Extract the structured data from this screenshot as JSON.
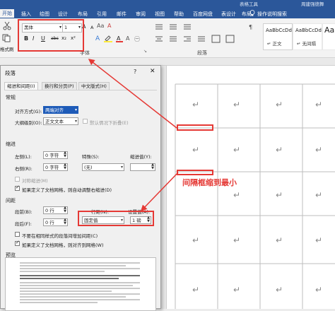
{
  "ribbon": {
    "context_title": "表格工具",
    "user_name": "周建强德舞",
    "tabs": [
      "开始",
      "插入",
      "绘图",
      "设计",
      "布局",
      "引用",
      "邮件",
      "审阅",
      "视图",
      "帮助",
      "百度网盘",
      "表设计",
      "布局"
    ],
    "tell_me": "操作说明搜索",
    "font_name": "黑体",
    "font_size": "1",
    "font_size_inc": "A",
    "font_size_dec": "A",
    "format_buttons": [
      "B",
      "I",
      "U",
      "abc",
      "x₂",
      "x²"
    ],
    "font_group_label": "字体",
    "paragraph_group_label": "段落",
    "clipboard_label": "格式刷",
    "styles": [
      {
        "preview": "AaBbCcDd",
        "name": "↵ 正文"
      },
      {
        "preview": "AaBbCcDd",
        "name": "↵ 无间隔"
      },
      {
        "preview": "AaB",
        "name": ""
      }
    ]
  },
  "dialog": {
    "title": "段落",
    "help": "?",
    "close": "✕",
    "tabs": [
      "缩进和间距(I)",
      "换行和分页(P)",
      "中文版式(H)"
    ],
    "general": {
      "heading": "常规",
      "alignment_label": "对齐方式(G):",
      "alignment_value": "两端对齐",
      "outline_label": "大纲级别(O):",
      "outline_value": "正文文本",
      "collapse_label": "默认情况下折叠(E)"
    },
    "indent": {
      "heading": "缩进",
      "left_label": "左侧(L):",
      "left_value": "0 字符",
      "right_label": "右侧(R):",
      "right_value": "0 字符",
      "special_label": "特殊(S):",
      "special_value": "(无)",
      "by_label": "缩进值(Y):",
      "mirror_label": "对称缩进(M)",
      "auto_adjust_label": "如果定义了文档网格，则自动调整右缩进(D)"
    },
    "spacing": {
      "heading": "间距",
      "before_label": "段前(B):",
      "before_value": "0 行",
      "after_label": "段后(F):",
      "after_value": "0 行",
      "line_label": "行距(N):",
      "line_value": "固定值",
      "at_label": "设置值(A):",
      "at_value": "1 磅",
      "no_space_label": "不要在相同样式的段落间增加间距(C)",
      "snap_label": "如果定义了文档网格，则对齐到网格(W)"
    },
    "preview_heading": "预览"
  },
  "annotation": "间隔框缩到最小",
  "document": {
    "cell_mark": "↵"
  },
  "colors": {
    "ribbon": "#2b579a",
    "highlight": "#e53935",
    "accent_select": "#1e5bb8"
  }
}
